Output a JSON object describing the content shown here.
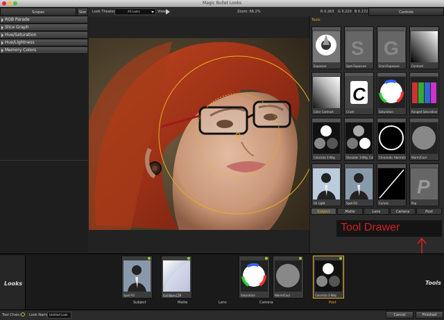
{
  "window": {
    "title": "Magic Bullet Looks"
  },
  "topbar": {
    "scopes_tab": "Scopes",
    "size_btn": "Size",
    "look_theater": "Look Theater",
    "look_select": "All Looks",
    "view_label": "View",
    "zoom": "Zoom: 66.2%",
    "r": "R 0.263",
    "g": "G 0.220",
    "b": "B 0.172",
    "controls_tab": "Controls"
  },
  "scopes": {
    "items": [
      {
        "label": "RGB Parade"
      },
      {
        "label": "Slice Graph"
      },
      {
        "label": "Hue/Saturation"
      },
      {
        "label": "Hue/Lightness"
      },
      {
        "label": "Memory Colors"
      }
    ]
  },
  "tools_panel": {
    "heading": "Tools",
    "tools": [
      {
        "label": "Exposure"
      },
      {
        "label": "Spot Exposure"
      },
      {
        "label": "Grad Exposure"
      },
      {
        "label": "Contrast"
      },
      {
        "label": "Color Contrast"
      },
      {
        "label": "Crush"
      },
      {
        "label": "Saturation"
      },
      {
        "label": "Ranged Saturation"
      },
      {
        "label": "Colorista 3-Way"
      },
      {
        "label": "Shoulder 3-Way Color Corrector"
      },
      {
        "label": "Chromatic Aberration"
      },
      {
        "label": "Warm/Cool"
      },
      {
        "label": "Fill Light"
      },
      {
        "label": "Spot Fill"
      },
      {
        "label": "Curves"
      },
      {
        "label": "Pop"
      }
    ],
    "categories": [
      "Subject",
      "Matte",
      "Lens",
      "Camera",
      "Post"
    ]
  },
  "annotation": {
    "tool_drawer": "Tool Drawer",
    "tools": "Tools"
  },
  "chain": {
    "looks_label": "Looks",
    "tools": [
      {
        "label": "Spot Fill",
        "sub": ""
      },
      {
        "label": "Full Blue CTB",
        "sub": "Lens Color Filter"
      },
      {
        "label": "Saturation",
        "sub": ""
      },
      {
        "label": "Warm/Cool",
        "sub": ""
      },
      {
        "label": "Colorista 3-Way",
        "sub": ""
      }
    ],
    "cat_labels": [
      "Subject",
      "Matte",
      "Lens",
      "Camera",
      "Post"
    ]
  },
  "status": {
    "tool_chain": "Tool Chain:",
    "look_name_label": "Look Name:",
    "look_name_value": "Untitled Look",
    "cancel": "Cancel",
    "finished": "Finished"
  },
  "colors": {
    "accent": "#e6b020",
    "annotation_red": "#d42020"
  }
}
